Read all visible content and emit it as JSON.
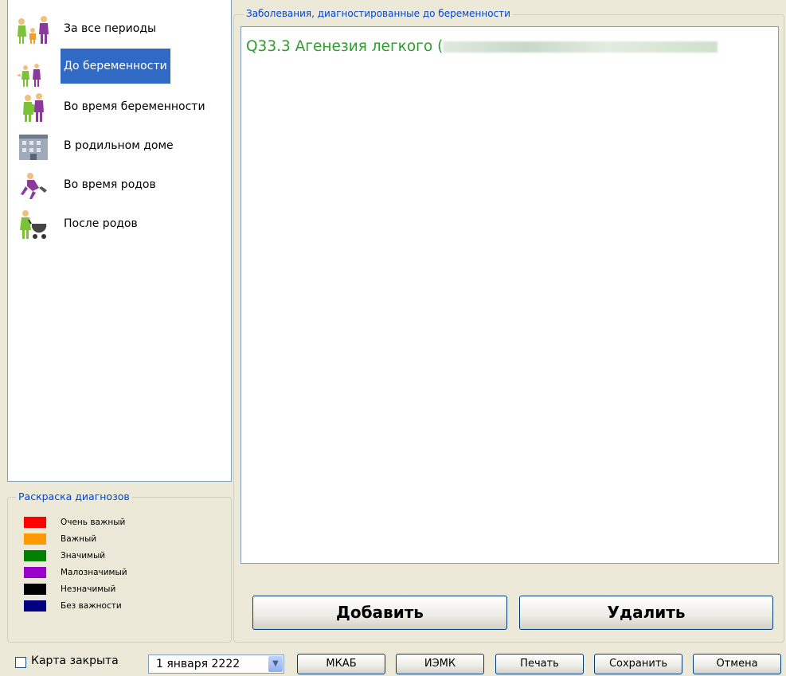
{
  "periods": [
    {
      "label": "За все периоды",
      "icon": "family-icon"
    },
    {
      "label": "До беременности",
      "icon": "couple-icon"
    },
    {
      "label": "Во время беременности",
      "icon": "pregnant-icon"
    },
    {
      "label": "В родильном доме",
      "icon": "hospital-building-icon"
    },
    {
      "label": "Во время родов",
      "icon": "labor-icon"
    },
    {
      "label": "После родов",
      "icon": "mother-stroller-icon"
    }
  ],
  "selected_period": "До беременности",
  "legend": {
    "title": "Раскраска диагнозов",
    "items": [
      {
        "label": "Очень важный",
        "color": "#ff0000"
      },
      {
        "label": "Важный",
        "color": "#ff9900"
      },
      {
        "label": "Значимый",
        "color": "#008000"
      },
      {
        "label": "Малозначимый",
        "color": "#9900cc"
      },
      {
        "label": "Незначимый",
        "color": "#000000"
      },
      {
        "label": "Без важности",
        "color": "#000080"
      }
    ]
  },
  "diagnoses": {
    "title": "Заболевания, диагностированные до беременности",
    "items": [
      {
        "text": "Q33.3 Агенезия легкого (",
        "color": "#2d9d2d"
      }
    ]
  },
  "actions": {
    "add": "Добавить",
    "delete": "Удалить"
  },
  "footer": {
    "card_closed_label": "Карта закрыта",
    "card_closed_checked": false,
    "date": "1  января  2222",
    "mkab": "МКАБ",
    "izmk": "ИЭМК",
    "print": "Печать",
    "save": "Сохранить",
    "cancel": "Отмена"
  }
}
